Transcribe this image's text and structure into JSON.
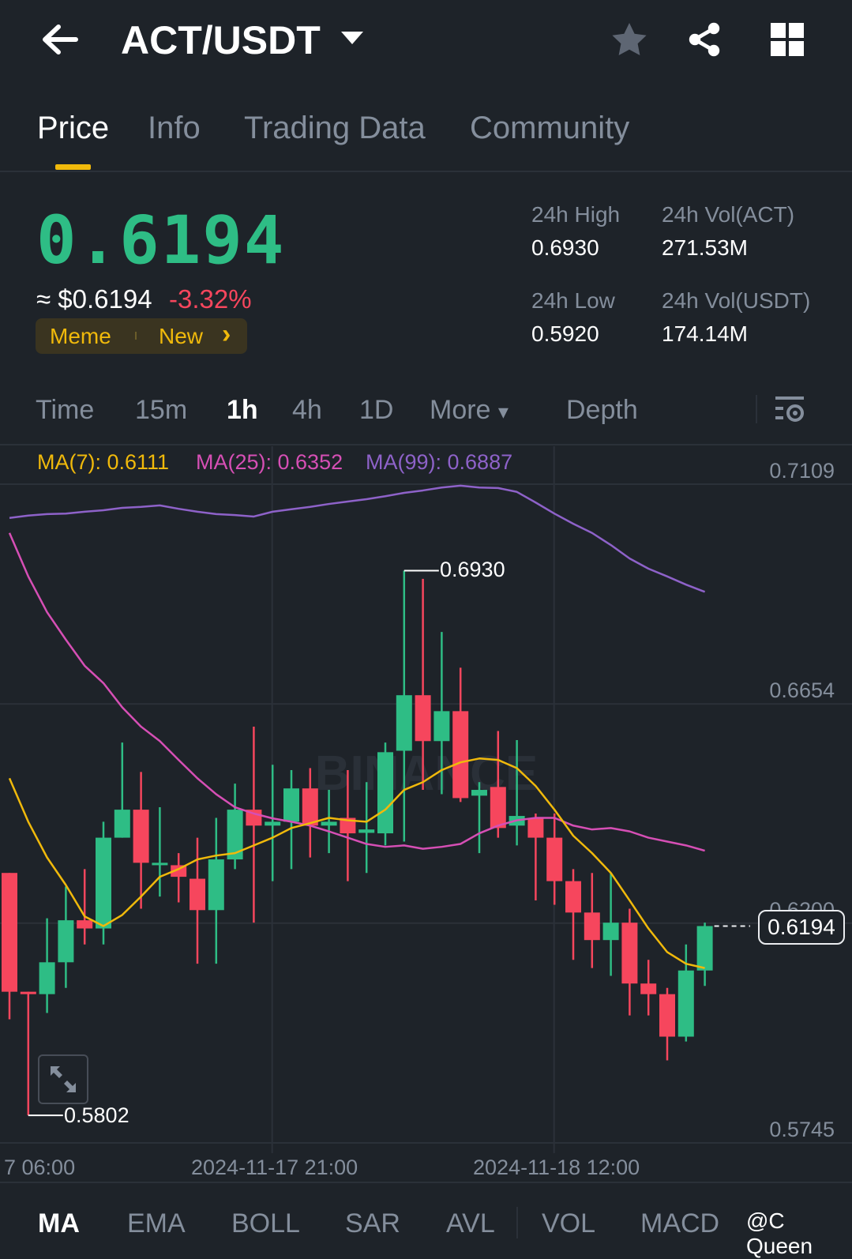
{
  "header": {
    "title": "ACT/USDT",
    "icons": [
      "back-arrow-icon",
      "caret-down-icon",
      "star-icon",
      "share-icon",
      "grid-icon"
    ]
  },
  "tabs": [
    {
      "label": "Price"
    },
    {
      "label": "Info"
    },
    {
      "label": "Trading Data"
    },
    {
      "label": "Community"
    }
  ],
  "ticker": {
    "price": "0.6194",
    "fiat": "≈ $0.6194",
    "change": "-3.32%",
    "tags": [
      "Meme",
      "New"
    ],
    "tag_arrow": "›"
  },
  "stats": {
    "high_label": "24h High",
    "high": "0.6930",
    "low_label": "24h Low",
    "low": "0.5920",
    "vol_act_label": "24h Vol(ACT)",
    "vol_act": "271.53M",
    "vol_usdt_label": "24h Vol(USDT)",
    "vol_usdt": "174.14M"
  },
  "intervals": {
    "items": [
      "Time",
      "15m",
      "1h",
      "4h",
      "1D",
      "More"
    ],
    "active": "1h",
    "more_caret": "▾",
    "depth": "Depth"
  },
  "colors": {
    "bg": "#1e2329",
    "up": "#2ebd85",
    "down": "#f6465d",
    "ma7": "#f0b90b",
    "ma25": "#d64fb5",
    "ma99": "#8e62c9"
  },
  "chart_data": {
    "type": "candlestick",
    "legend": {
      "ma7": "MA(7): 0.6111",
      "ma25": "MA(25): 0.6352",
      "ma99": "MA(99): 0.6887"
    },
    "y_ticks": [
      "0.7109",
      "0.6654",
      "0.6200",
      "0.5745"
    ],
    "y_tick_values": [
      0.7109,
      0.6654,
      0.62,
      0.5745
    ],
    "ylim": [
      0.5745,
      0.7109
    ],
    "x_labels": [
      "7 06:00",
      "2024-11-17 21:00",
      "2024-11-18 12:00"
    ],
    "x_label_candle_index": [
      -0.5,
      14,
      29
    ],
    "high_marker": {
      "label": "0.6930",
      "value": 0.693,
      "index": 21
    },
    "low_marker": {
      "label": "0.5802",
      "value": 0.5802,
      "index": 1
    },
    "last_price": {
      "label": "0.6194",
      "value": 0.6194
    },
    "watermark": "BINANCE",
    "candles": [
      [
        0.6304,
        0.6304,
        0.6001,
        0.6058
      ],
      [
        0.6058,
        0.6058,
        0.5802,
        0.6053
      ],
      [
        0.6053,
        0.621,
        0.6014,
        0.6119
      ],
      [
        0.6119,
        0.6276,
        0.6066,
        0.6206
      ],
      [
        0.6206,
        0.6312,
        0.6156,
        0.6189
      ],
      [
        0.6189,
        0.641,
        0.6156,
        0.6377
      ],
      [
        0.6377,
        0.6574,
        0.6377,
        0.6435
      ],
      [
        0.6435,
        0.6513,
        0.623,
        0.6325
      ],
      [
        0.632,
        0.644,
        0.6255,
        0.6325
      ],
      [
        0.632,
        0.6345,
        0.6243,
        0.6296
      ],
      [
        0.6292,
        0.6377,
        0.6116,
        0.6227
      ],
      [
        0.6227,
        0.6418,
        0.6116,
        0.6332
      ],
      [
        0.6332,
        0.6489,
        0.6312,
        0.6435
      ],
      [
        0.6435,
        0.6607,
        0.6201,
        0.6402
      ],
      [
        0.6402,
        0.6528,
        0.6287,
        0.641
      ],
      [
        0.641,
        0.6517,
        0.6312,
        0.6479
      ],
      [
        0.6479,
        0.6521,
        0.6336,
        0.6402
      ],
      [
        0.6402,
        0.6476,
        0.6345,
        0.641
      ],
      [
        0.6418,
        0.6517,
        0.6287,
        0.6386
      ],
      [
        0.6387,
        0.6492,
        0.6304,
        0.6394
      ],
      [
        0.6386,
        0.6574,
        0.6361,
        0.6554
      ],
      [
        0.6557,
        0.693,
        0.6369,
        0.6672
      ],
      [
        0.6672,
        0.6913,
        0.6476,
        0.6577
      ],
      [
        0.6577,
        0.6803,
        0.6467,
        0.6639
      ],
      [
        0.6639,
        0.6729,
        0.6451,
        0.6459
      ],
      [
        0.6464,
        0.6492,
        0.6345,
        0.6476
      ],
      [
        0.6482,
        0.6598,
        0.6377,
        0.6397
      ],
      [
        0.6402,
        0.6579,
        0.6361,
        0.6422
      ],
      [
        0.6417,
        0.6427,
        0.6247,
        0.6377
      ],
      [
        0.6377,
        0.6427,
        0.6238,
        0.6287
      ],
      [
        0.6287,
        0.6312,
        0.6124,
        0.6222
      ],
      [
        0.6222,
        0.6304,
        0.6107,
        0.6165
      ],
      [
        0.6165,
        0.6304,
        0.6091,
        0.6201
      ],
      [
        0.6201,
        0.623,
        0.6009,
        0.6075
      ],
      [
        0.6075,
        0.6124,
        0.6009,
        0.6053
      ],
      [
        0.6053,
        0.6066,
        0.5916,
        0.5965
      ],
      [
        0.5965,
        0.6156,
        0.5955,
        0.6102
      ],
      [
        0.6102,
        0.6201,
        0.607,
        0.6194
      ]
    ],
    "ma7": [
      0.65,
      0.641,
      0.6336,
      0.6279,
      0.6214,
      0.6194,
      0.6217,
      0.6255,
      0.6296,
      0.6312,
      0.6332,
      0.634,
      0.6345,
      0.6361,
      0.6377,
      0.6397,
      0.6407,
      0.6418,
      0.6413,
      0.641,
      0.6435,
      0.6476,
      0.6492,
      0.6517,
      0.6533,
      0.6541,
      0.6538,
      0.6521,
      0.6484,
      0.6435,
      0.6381,
      0.6345,
      0.6304,
      0.6247,
      0.6189,
      0.614,
      0.6116,
      0.6107
    ],
    "ma25": [
      0.7008,
      0.6918,
      0.6844,
      0.6787,
      0.6733,
      0.6697,
      0.6647,
      0.6607,
      0.6577,
      0.6538,
      0.65,
      0.6467,
      0.644,
      0.6427,
      0.6417,
      0.641,
      0.6402,
      0.639,
      0.6377,
      0.6364,
      0.6358,
      0.6361,
      0.6354,
      0.6358,
      0.6364,
      0.6386,
      0.6402,
      0.6413,
      0.6418,
      0.6418,
      0.6402,
      0.6394,
      0.6397,
      0.639,
      0.6377,
      0.6369,
      0.6361,
      0.635
    ],
    "ma99": [
      0.7039,
      0.7044,
      0.7047,
      0.7048,
      0.7052,
      0.7055,
      0.706,
      0.7062,
      0.7065,
      0.7058,
      0.7052,
      0.7047,
      0.7045,
      0.7042,
      0.7052,
      0.7057,
      0.7062,
      0.7068,
      0.7073,
      0.7078,
      0.7084,
      0.7091,
      0.7096,
      0.7102,
      0.7106,
      0.7102,
      0.7101,
      0.7093,
      0.7071,
      0.7048,
      0.7027,
      0.7008,
      0.6983,
      0.6955,
      0.6934,
      0.6918,
      0.6901,
      0.6886
    ]
  },
  "indicators": {
    "items": [
      "MA",
      "EMA",
      "BOLL",
      "SAR",
      "AVL",
      "VOL",
      "MACD"
    ],
    "active": "MA"
  },
  "watermark_user": "@C Queen"
}
